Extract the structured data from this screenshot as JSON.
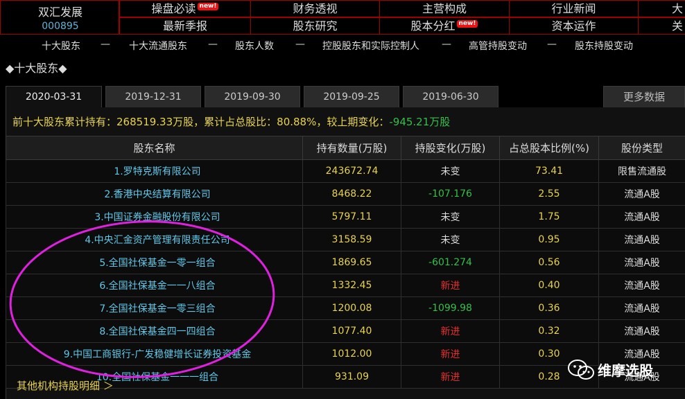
{
  "stock": {
    "name": "双汇发展",
    "code": "000895"
  },
  "topnav": {
    "row1": [
      "操盘必读",
      "财务透视",
      "主营构成",
      "行业新闻",
      "大"
    ],
    "row2": [
      "最新季报",
      "股东研究",
      "股本分红",
      "资本运作",
      "关"
    ],
    "new_badge": "new!"
  },
  "subnav": {
    "items": [
      "十大股东",
      "十大流通股东",
      "股东人数",
      "控股股东和实际控制人",
      "高管持股变动",
      "股东持股变动"
    ],
    "separator": "—"
  },
  "section_title": "◆十大股东◆",
  "tabs": [
    "2020-03-31",
    "2019-12-31",
    "2019-09-30",
    "2019-09-25",
    "2019-06-30"
  ],
  "more_data": "更多数据",
  "summary": {
    "prefix": "前十大股东累计持有：",
    "total": "268519.33万股",
    "ratio_label": "，累计占总股比：",
    "ratio": "80.88%",
    "change_label": "，较上期变化：",
    "change": "-945.21万股"
  },
  "table": {
    "headers": [
      "股东名称",
      "持有数量(万股)",
      "持股变化(万股)",
      "占总股本比例(%)",
      "股份类型"
    ],
    "rows": [
      {
        "name": "1.罗特克斯有限公司",
        "amount": "243672.74",
        "change": "未变",
        "pct": "73.41",
        "type": "限售流通股"
      },
      {
        "name": "2.香港中央结算有限公司",
        "amount": "8468.22",
        "change": "-107.176",
        "pct": "2.55",
        "type": "流通A股"
      },
      {
        "name": "3.中国证券金融股份有限公司",
        "amount": "5797.11",
        "change": "未变",
        "pct": "1.75",
        "type": "流通A股"
      },
      {
        "name": "4.中央汇金资产管理有限责任公司",
        "amount": "3158.59",
        "change": "未变",
        "pct": "0.95",
        "type": "流通A股"
      },
      {
        "name": "5.全国社保基金一零一组合",
        "amount": "1869.65",
        "change": "-601.274",
        "pct": "0.56",
        "type": "流通A股"
      },
      {
        "name": "6.全国社保基金一一八组合",
        "amount": "1332.45",
        "change": "新进",
        "pct": "0.40",
        "type": "流通A股"
      },
      {
        "name": "7.全国社保基金一零三组合",
        "amount": "1200.08",
        "change": "-1099.98",
        "pct": "0.36",
        "type": "流通A股"
      },
      {
        "name": "8.全国社保基金四一四组合",
        "amount": "1077.40",
        "change": "新进",
        "pct": "0.32",
        "type": "流通A股"
      },
      {
        "name": "9.中国工商银行-广发稳健增长证券投资基金",
        "amount": "1012.00",
        "change": "新进",
        "pct": "0.30",
        "type": "流通A股"
      },
      {
        "name": "10.全国社保基金一一一组合",
        "amount": "931.09",
        "change": "新进",
        "pct": "0.28",
        "type": "流通A股"
      }
    ]
  },
  "footer_link": "其他机构持股明细 ＞",
  "watermark": "维摩选股",
  "colors": {
    "accent_yellow": "#e8d44d",
    "link_blue": "#5fc8e8",
    "down_green": "#33c04a",
    "new_red": "#e53030",
    "annotation_magenta": "#e020e0"
  }
}
